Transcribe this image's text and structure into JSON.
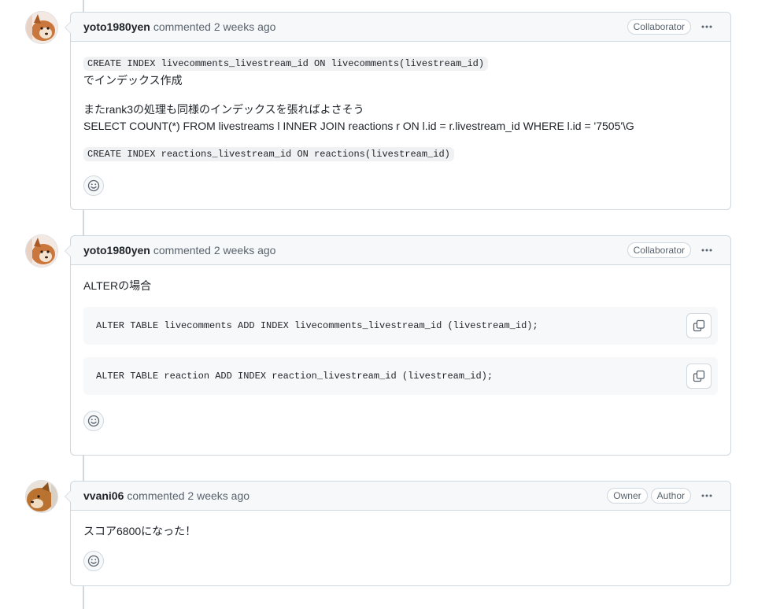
{
  "comments": [
    {
      "author": "yoto1980yen",
      "meta": "commented 2 weeks ago",
      "badges": [
        "Collaborator"
      ],
      "inline_code_1": "CREATE INDEX livecomments_livestream_id ON livecomments(livestream_id)",
      "text_1": "でインデックス作成",
      "text_2": "またrank3の処理も同様のインデックスを張ればよさそう",
      "text_3": "SELECT COUNT(*) FROM livestreams l INNER JOIN reactions r ON l.id = r.livestream_id WHERE l.id = '7505'\\G",
      "inline_code_2": "CREATE INDEX reactions_livestream_id ON reactions(livestream_id)"
    },
    {
      "author": "yoto1980yen",
      "meta": "commented 2 weeks ago",
      "badges": [
        "Collaborator"
      ],
      "text_1": "ALTERの場合",
      "code_1": "ALTER TABLE livecomments ADD INDEX livecomments_livestream_id (livestream_id);",
      "code_2": "ALTER TABLE reaction ADD INDEX reaction_livestream_id (livestream_id);"
    },
    {
      "author": "vvani06",
      "meta": "commented 2 weeks ago",
      "badges": [
        "Owner",
        "Author"
      ],
      "text_1": "スコア6800になった！"
    }
  ],
  "icons": {
    "kebab": "kebab-horizontal-icon",
    "smiley": "smiley-icon",
    "copy": "copy-icon"
  }
}
